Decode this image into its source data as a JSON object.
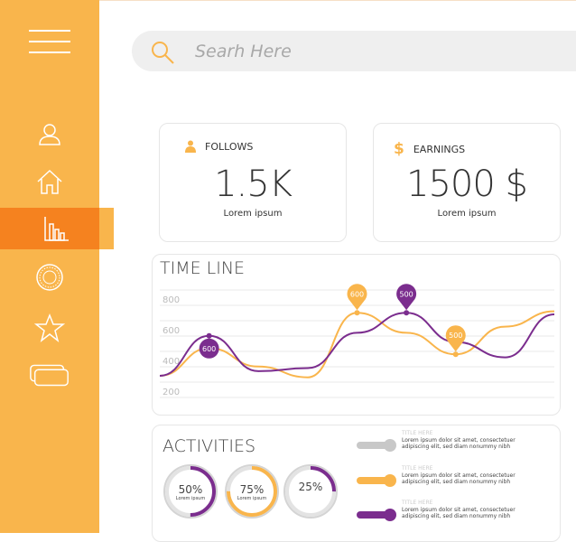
{
  "search": {
    "placeholder": "Searh Here"
  },
  "sidebar": {
    "items": [
      {
        "icon": "user-icon"
      },
      {
        "icon": "home-icon"
      },
      {
        "icon": "bar-chart-icon",
        "active": true
      },
      {
        "icon": "sun-dial-icon"
      },
      {
        "icon": "star-icon"
      },
      {
        "icon": "cards-icon"
      }
    ]
  },
  "stats": [
    {
      "label": "FOLLOWS",
      "icon": "person-icon",
      "value": "1.5K",
      "sub": "Lorem ipsum"
    },
    {
      "label": "EARNINGS",
      "icon": "dollar-icon",
      "value": "1500 $",
      "sub": "Lorem ipsum"
    }
  ],
  "timeline": {
    "title": "TIME LINE",
    "y_ticks": [
      "800",
      "600",
      "400",
      "200"
    ],
    "markers": [
      {
        "label": "600",
        "series": "purple"
      },
      {
        "label": "600",
        "series": "orange"
      },
      {
        "label": "500",
        "series": "purple"
      },
      {
        "label": "500",
        "series": "orange"
      }
    ]
  },
  "chart_data": {
    "type": "line",
    "title": "TIME LINE",
    "xlabel": "",
    "ylabel": "",
    "ylim": [
      100,
      900
    ],
    "x": [
      0,
      1,
      2,
      3,
      4,
      5,
      6,
      7,
      8
    ],
    "series": [
      {
        "color": "#f9b54c",
        "values": [
          300,
          480,
          360,
          290,
          710,
          580,
          440,
          620,
          720
        ]
      },
      {
        "color": "#7b2d8e",
        "values": [
          300,
          560,
          330,
          350,
          580,
          710,
          520,
          420,
          700
        ]
      }
    ],
    "grid": true
  },
  "activities": {
    "title": "ACTIVITIES",
    "rings": [
      {
        "label": "50%",
        "sub": "Lorem ipsum",
        "value": 0.5,
        "color": "#7b2d8e"
      },
      {
        "label": "75%",
        "sub": "Lorem ipsum",
        "value": 0.75,
        "color": "#f9b54c"
      },
      {
        "label": "25%",
        "sub": "",
        "value": 0.25,
        "color": "#7b2d8e"
      }
    ],
    "legend": [
      {
        "title": "TITLE HERE",
        "text": "Lorem ipsum dolor sit amet, consectetuer adipiscing elit, sed diam nonummy nibh",
        "color": "#c8c8c8"
      },
      {
        "title": "TITLE HERE",
        "text": "Lorem ipsum dolor sit amet, consectetuer adipiscing elit, sed diam nonummy nibh",
        "color": "#f9b54c"
      },
      {
        "title": "TITLE HERE",
        "text": "Lorem ipsum dolor sit amet, consectetuer adipiscing elit, sed diam nonummy nibh",
        "color": "#7b2d8e"
      }
    ]
  },
  "colors": {
    "sidebar": "#f9b54c",
    "active": "#f5821f",
    "accent_orange": "#f9b54c",
    "accent_purple": "#7b2d8e"
  }
}
